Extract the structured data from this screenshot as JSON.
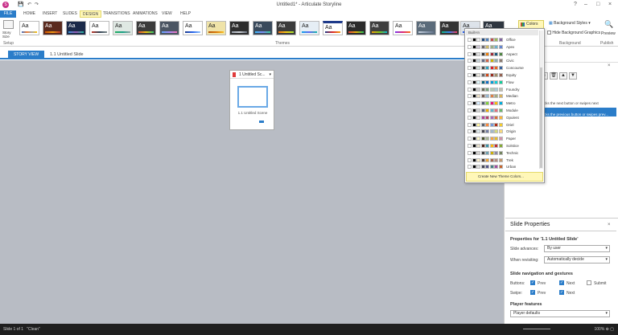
{
  "app": {
    "logo": "S",
    "title": "Untitled1* - Articulate Storyline"
  },
  "menu": {
    "file": "FILE",
    "tabs": [
      "HOME",
      "INSERT",
      "SLIDES",
      "DESIGN",
      "TRANSITIONS",
      "ANIMATIONS",
      "VIEW",
      "HELP"
    ]
  },
  "ribbon": {
    "story_size": "Story Size",
    "setup": "Setup",
    "themes_label": "Themes",
    "theme_thumb_text": "Aa",
    "colors_button": "Colors",
    "background_styles": "Background Styles",
    "hide_background": "Hide Background Graphics",
    "background_label": "Background",
    "preview": "Preview",
    "publish": "Publish"
  },
  "view": {
    "story_view": "STORY VIEW",
    "breadcrumb": "1.1 Untitled Slide"
  },
  "scene": {
    "title": "1 Untitled Sc...",
    "slide_label": "1.1 Untitled Scene"
  },
  "colors_dropdown": {
    "header": "Built-In",
    "themes": [
      "Office",
      "Apex",
      "Aspect",
      "Civic",
      "Concourse",
      "Equity",
      "Flow",
      "Foundry",
      "Median",
      "Metro",
      "Module",
      "Opulent",
      "Oriel",
      "Origin",
      "Paper",
      "Solstice",
      "Technic",
      "Trek",
      "Urban"
    ],
    "create": "Create New Theme Colors..."
  },
  "triggers": {
    "item1": "cks the next button or swipes next",
    "item2": "cks the previous button or swipes prev..."
  },
  "properties": {
    "title": "Slide Properties",
    "for_slide": "Properties for '1.1 Untitled Slide'",
    "slide_advances_label": "Slide advances:",
    "slide_advances_value": "By user",
    "revisiting_label": "When revisiting:",
    "revisiting_value": "Automatically decide",
    "nav_section": "Slide navigation and gestures",
    "buttons_label": "Buttons:",
    "swipe_label": "Swipe:",
    "prev": "Prev",
    "next": "Next",
    "submit": "Submit",
    "player_section": "Player features",
    "player_value": "Player defaults"
  },
  "status": {
    "slide": "Slide 1 of 1",
    "theme": "\"Clean\"",
    "zoom": "100%"
  }
}
